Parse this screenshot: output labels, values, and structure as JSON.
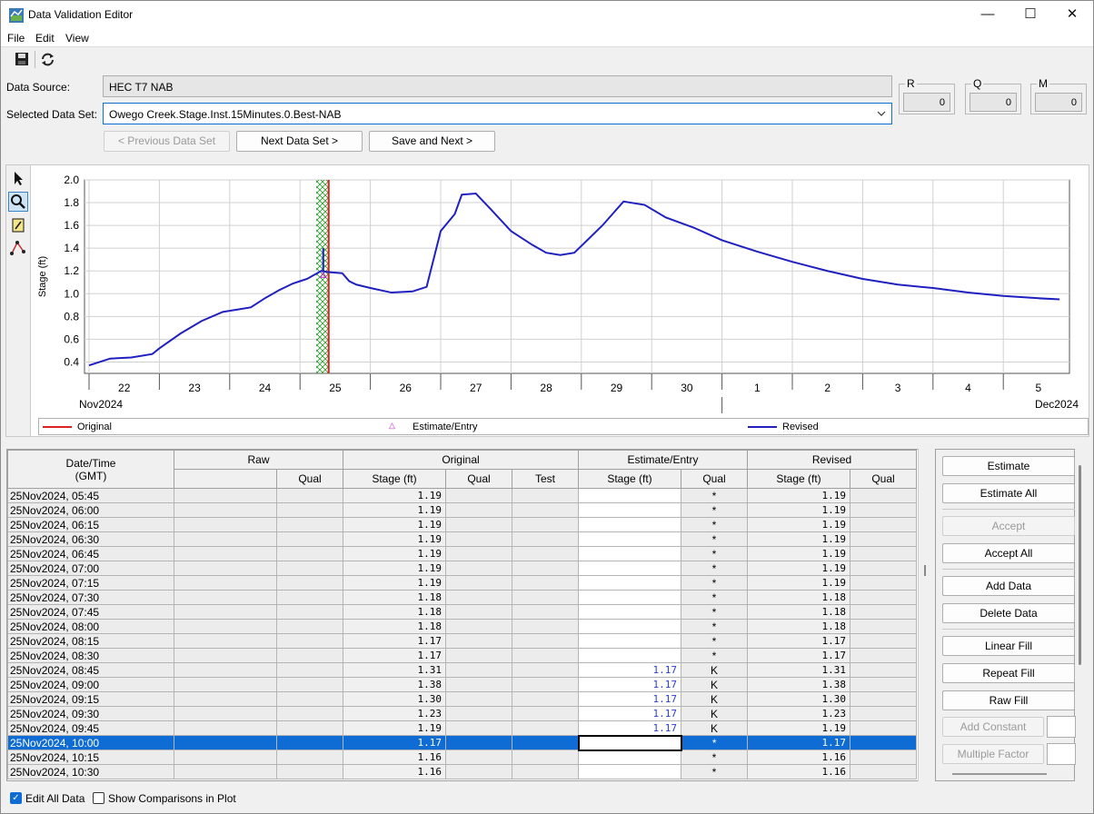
{
  "window": {
    "title": "Data Validation Editor",
    "minimize": "—",
    "maximize": "☐",
    "close": "✕"
  },
  "menu": [
    "File",
    "Edit",
    "View"
  ],
  "form": {
    "data_source_label": "Data Source:",
    "data_source_value": "HEC T7 NAB",
    "dataset_label": "Selected Data Set:",
    "dataset_value": "Owego Creek.Stage.Inst.15Minutes.0.Best-NAB",
    "prev_button": "< Previous Data Set",
    "next_button": "Next Data Set >",
    "save_next_button": "Save and Next >",
    "counters": [
      {
        "label": "R",
        "value": "0"
      },
      {
        "label": "Q",
        "value": "0"
      },
      {
        "label": "M",
        "value": "0"
      }
    ]
  },
  "chart_data": {
    "type": "line",
    "ylabel": "Stage (ft)",
    "ylim": [
      0.3,
      2.0
    ],
    "yticks": [
      "2.0",
      "1.8",
      "1.6",
      "1.4",
      "1.2",
      "1.0",
      "0.8",
      "0.6",
      "0.4"
    ],
    "xticks_days": [
      "22",
      "23",
      "24",
      "25",
      "26",
      "27",
      "28",
      "29",
      "30",
      "1",
      "2",
      "3",
      "4",
      "5"
    ],
    "month_labels": [
      "Nov2024",
      "Dec2024"
    ],
    "legend": [
      {
        "name": "Original",
        "color": "#e02020"
      },
      {
        "name": "Estimate/Entry",
        "color": "#d020d0"
      },
      {
        "name": "Revised",
        "color": "#2020c0"
      }
    ],
    "grid": true,
    "series": [
      {
        "name": "Revised",
        "x_days": [
          0.0,
          0.1,
          0.3,
          0.6,
          0.9,
          1.0,
          1.3,
          1.6,
          1.9,
          2.1,
          2.3,
          2.5,
          2.7,
          2.9,
          3.0,
          3.1,
          3.3,
          3.4,
          3.6,
          3.7,
          3.8,
          4.0,
          4.3,
          4.6,
          4.8,
          5.0,
          5.2,
          5.3,
          5.5,
          5.7,
          6.0,
          6.3,
          6.5,
          6.7,
          6.9,
          7.3,
          7.6,
          7.9,
          8.2,
          8.6,
          9.0,
          9.5,
          10.0,
          10.5,
          11.0,
          11.5,
          12.0,
          12.5,
          13.0,
          13.5,
          13.8
        ],
        "values": [
          0.37,
          0.39,
          0.43,
          0.44,
          0.47,
          0.52,
          0.65,
          0.76,
          0.84,
          0.86,
          0.88,
          0.96,
          1.03,
          1.09,
          1.11,
          1.13,
          1.2,
          1.19,
          1.18,
          1.11,
          1.08,
          1.05,
          1.01,
          1.02,
          1.06,
          1.55,
          1.7,
          1.87,
          1.88,
          1.75,
          1.55,
          1.43,
          1.36,
          1.34,
          1.36,
          1.6,
          1.81,
          1.78,
          1.67,
          1.58,
          1.47,
          1.37,
          1.28,
          1.2,
          1.13,
          1.08,
          1.05,
          1.01,
          0.98,
          0.96,
          0.95
        ]
      }
    ],
    "highlight_band_days": [
      3.23,
      3.42
    ],
    "spike": {
      "x_day": 3.33,
      "value": 1.4
    }
  },
  "table": {
    "group_headers": [
      "Date/Time",
      "Raw",
      "Original",
      "Estimate/Entry",
      "Revised"
    ],
    "datetime_sub": "(GMT)",
    "sub_headers": [
      "Qual",
      "Stage (ft)",
      "Qual",
      "Test",
      "Stage (ft)",
      "Qual",
      "Stage (ft)",
      "Qual"
    ],
    "rows": [
      {
        "dt": "25Nov2024, 05:45",
        "orig": "1.19",
        "est": "",
        "q": "*",
        "rev": "1.19"
      },
      {
        "dt": "25Nov2024, 06:00",
        "orig": "1.19",
        "est": "",
        "q": "*",
        "rev": "1.19"
      },
      {
        "dt": "25Nov2024, 06:15",
        "orig": "1.19",
        "est": "",
        "q": "*",
        "rev": "1.19"
      },
      {
        "dt": "25Nov2024, 06:30",
        "orig": "1.19",
        "est": "",
        "q": "*",
        "rev": "1.19"
      },
      {
        "dt": "25Nov2024, 06:45",
        "orig": "1.19",
        "est": "",
        "q": "*",
        "rev": "1.19"
      },
      {
        "dt": "25Nov2024, 07:00",
        "orig": "1.19",
        "est": "",
        "q": "*",
        "rev": "1.19"
      },
      {
        "dt": "25Nov2024, 07:15",
        "orig": "1.19",
        "est": "",
        "q": "*",
        "rev": "1.19"
      },
      {
        "dt": "25Nov2024, 07:30",
        "orig": "1.18",
        "est": "",
        "q": "*",
        "rev": "1.18"
      },
      {
        "dt": "25Nov2024, 07:45",
        "orig": "1.18",
        "est": "",
        "q": "*",
        "rev": "1.18"
      },
      {
        "dt": "25Nov2024, 08:00",
        "orig": "1.18",
        "est": "",
        "q": "*",
        "rev": "1.18"
      },
      {
        "dt": "25Nov2024, 08:15",
        "orig": "1.17",
        "est": "",
        "q": "*",
        "rev": "1.17"
      },
      {
        "dt": "25Nov2024, 08:30",
        "orig": "1.17",
        "est": "",
        "q": "*",
        "rev": "1.17"
      },
      {
        "dt": "25Nov2024, 08:45",
        "orig": "1.31",
        "est": "1.17",
        "q": "K",
        "rev": "1.31"
      },
      {
        "dt": "25Nov2024, 09:00",
        "orig": "1.38",
        "est": "1.17",
        "q": "K",
        "rev": "1.38"
      },
      {
        "dt": "25Nov2024, 09:15",
        "orig": "1.30",
        "est": "1.17",
        "q": "K",
        "rev": "1.30"
      },
      {
        "dt": "25Nov2024, 09:30",
        "orig": "1.23",
        "est": "1.17",
        "q": "K",
        "rev": "1.23"
      },
      {
        "dt": "25Nov2024, 09:45",
        "orig": "1.19",
        "est": "1.17",
        "q": "K",
        "rev": "1.19"
      },
      {
        "dt": "25Nov2024, 10:00",
        "orig": "1.17",
        "est": "",
        "q": "*",
        "rev": "1.17",
        "selected": true
      },
      {
        "dt": "25Nov2024, 10:15",
        "orig": "1.16",
        "est": "",
        "q": "*",
        "rev": "1.16"
      },
      {
        "dt": "25Nov2024, 10:30",
        "orig": "1.16",
        "est": "",
        "q": "*",
        "rev": "1.16"
      }
    ]
  },
  "actions": {
    "estimate": "Estimate",
    "estimate_all": "Estimate All",
    "accept": "Accept",
    "accept_all": "Accept All",
    "add_data": "Add Data",
    "delete_data": "Delete Data",
    "linear_fill": "Linear Fill",
    "repeat_fill": "Repeat Fill",
    "raw_fill": "Raw Fill",
    "add_constant": "Add Constant",
    "multiple_factor": "Multiple Factor"
  },
  "bottom": {
    "edit_all_data": "Edit All Data",
    "show_comparisons": "Show Comparisons in Plot"
  }
}
